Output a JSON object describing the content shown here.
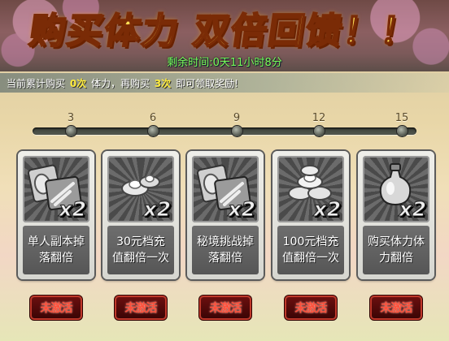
{
  "banner": {
    "title": "购买体力  双倍回馈！！",
    "remaining_label": "剩余时间:",
    "remaining_value": "0天11小时8分"
  },
  "info": {
    "prefix": "当前累计购买",
    "bought_count": "0次",
    "middle": "体力，再购买",
    "need_count": "3次",
    "suffix": "即可领取奖励!"
  },
  "progress": {
    "current": 0,
    "max": 15,
    "ticks": [
      "3",
      "6",
      "9",
      "12",
      "15"
    ]
  },
  "rewards": [
    {
      "icon": "scroll-icon",
      "multiplier": "x2",
      "label": "单人副本掉落翻倍",
      "status": "未激活"
    },
    {
      "icon": "silver-ingot-icon",
      "multiplier": "x2",
      "label": "30元档充值翻倍一次",
      "status": "未激活"
    },
    {
      "icon": "scroll-icon",
      "multiplier": "x2",
      "label": "秘境挑战掉落翻倍",
      "status": "未激活"
    },
    {
      "icon": "silver-ingot-pile-icon",
      "multiplier": "x2",
      "label": "100元档充值翻倍一次",
      "status": "未激活"
    },
    {
      "icon": "potion-bottle-icon",
      "multiplier": "x2",
      "label": "购买体力体力翻倍",
      "status": "未激活"
    }
  ],
  "colors": {
    "title": "#ffde55",
    "timer": "#7cff5a",
    "highlight": "#ffec3d",
    "inactive": "#ff4f3a"
  }
}
